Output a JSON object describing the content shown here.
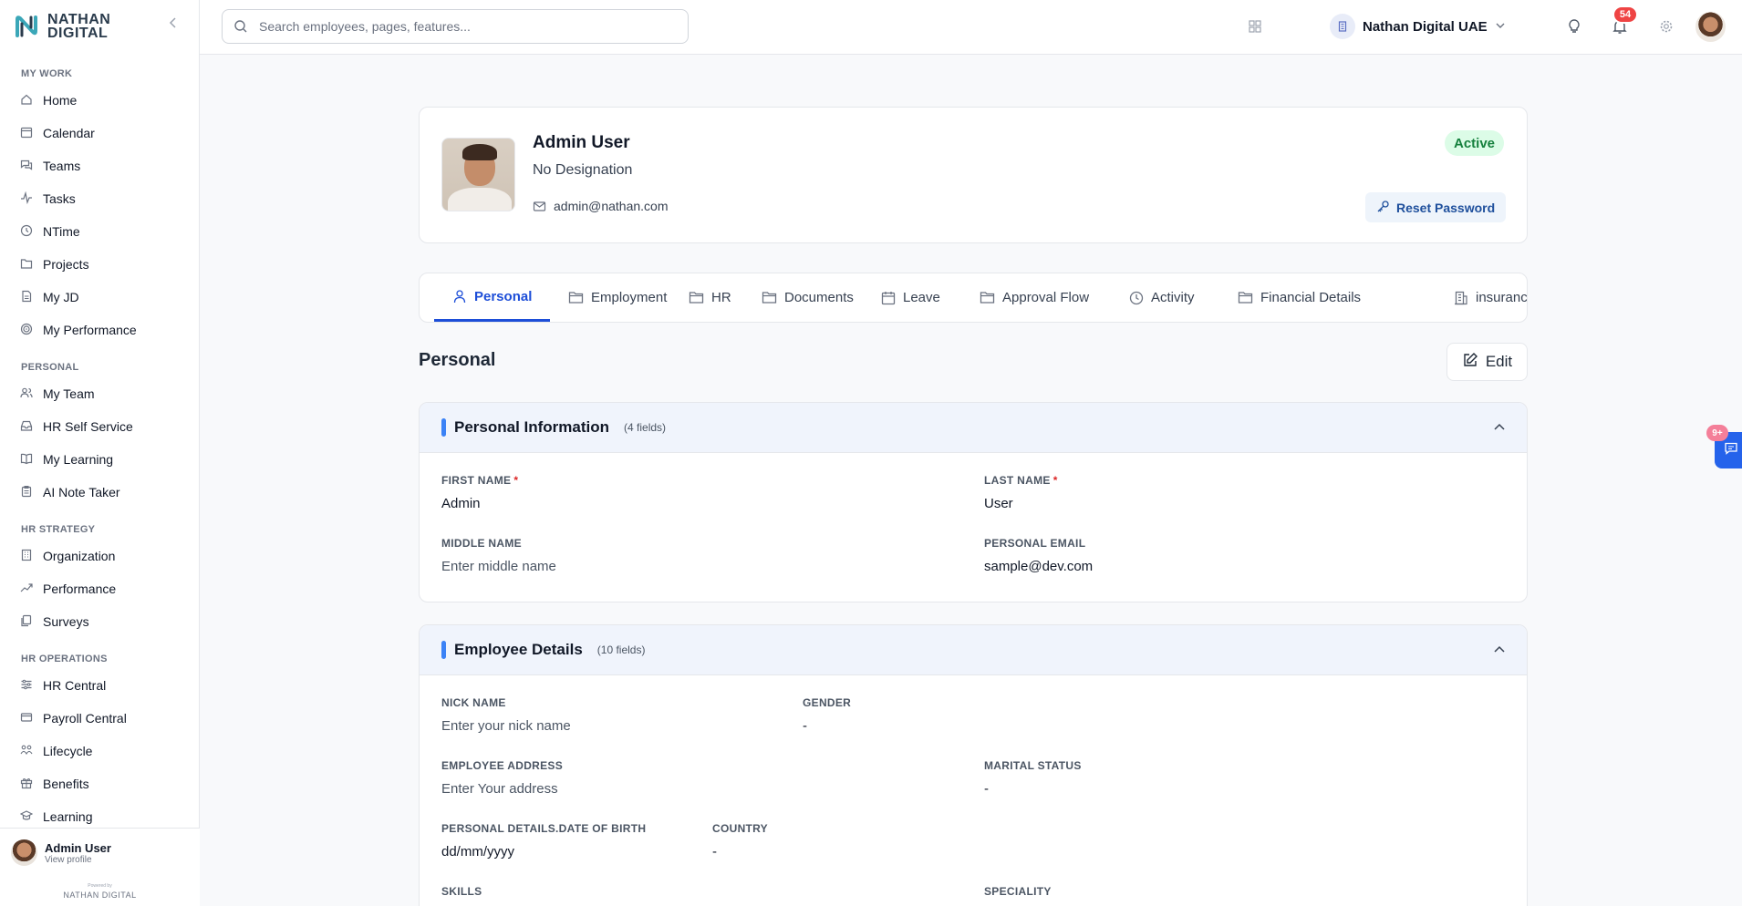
{
  "brand": {
    "line1": "NATHAN",
    "line2": "DIGITAL",
    "powered_by": "Powered by",
    "footer_logo": "NATHAN DIGITAL"
  },
  "sidebar": {
    "sections": [
      {
        "title": "MY WORK",
        "items": [
          "Home",
          "Calendar",
          "Teams",
          "Tasks",
          "NTime",
          "Projects",
          "My JD",
          "My Performance"
        ]
      },
      {
        "title": "PERSONAL",
        "items": [
          "My Team",
          "HR Self Service",
          "My Learning",
          "AI Note Taker"
        ]
      },
      {
        "title": "HR STRATEGY",
        "items": [
          "Organization",
          "Performance",
          "Surveys"
        ]
      },
      {
        "title": "HR OPERATIONS",
        "items": [
          "HR Central",
          "Payroll Central",
          "Lifecycle",
          "Benefits",
          "Learning"
        ]
      }
    ],
    "user": {
      "name": "Admin User",
      "link": "View profile"
    }
  },
  "topbar": {
    "search_placeholder": "Search employees, pages, features...",
    "org_name": "Nathan Digital UAE",
    "notification_count": "54"
  },
  "profile": {
    "name": "Admin User",
    "designation": "No Designation",
    "email": "admin@nathan.com",
    "status": "Active",
    "reset_label": "Reset Password"
  },
  "tabs": [
    "Personal",
    "Employment",
    "HR",
    "Documents",
    "Leave",
    "Approval Flow",
    "Activity",
    "Financial Details",
    "insurance"
  ],
  "section": {
    "title": "Personal",
    "edit_label": "Edit"
  },
  "personal_info": {
    "title": "Personal Information",
    "count": "(4 fields)",
    "first_name_label": "FIRST NAME",
    "first_name": "Admin",
    "last_name_label": "LAST NAME",
    "last_name": "User",
    "middle_name_label": "MIDDLE NAME",
    "middle_name_ph": "Enter middle name",
    "personal_email_label": "PERSONAL EMAIL",
    "personal_email": "sample@dev.com"
  },
  "employee_details": {
    "title": "Employee Details",
    "count": "(10 fields)",
    "nick_name_label": "NICK NAME",
    "nick_name_ph": "Enter your nick name",
    "gender_label": "GENDER",
    "gender": "-",
    "address_label": "EMPLOYEE ADDRESS",
    "address_ph": "Enter Your address",
    "marital_label": "MARITAL STATUS",
    "marital": "-",
    "dob_label": "PERSONAL DETAILS.DATE OF BIRTH",
    "dob": "dd/mm/yyyy",
    "country_label": "COUNTRY",
    "country": "-",
    "skills_label": "SKILLS",
    "speciality_label": "SPECIALITY"
  },
  "chat": {
    "badge": "9+"
  }
}
